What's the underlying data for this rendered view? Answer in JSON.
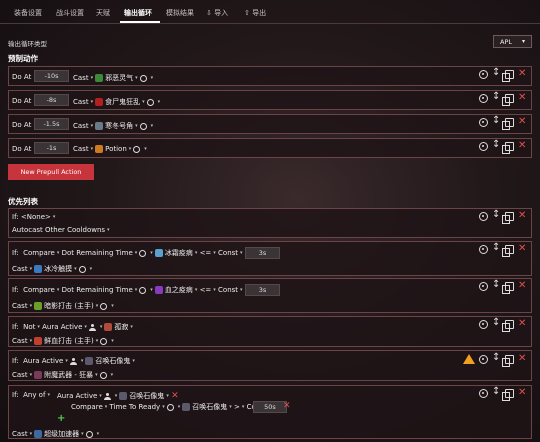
{
  "tabs": [
    "装备设置",
    "战斗设置",
    "天赋",
    "输出循环",
    "模拟结果",
    "导入",
    "导出"
  ],
  "active_tab": "输出循环",
  "section_type_label": "输出循环类型",
  "apl_select": "APL",
  "prepull_title": "预制动作",
  "prepull": [
    {
      "do_at": "Do At",
      "time": "-10s",
      "cast": "Cast",
      "spell": "邪恶灵气"
    },
    {
      "do_at": "Do At",
      "time": "-8s",
      "cast": "Cast",
      "spell": "食尸鬼狂乱"
    },
    {
      "do_at": "Do At",
      "time": "-1.5s",
      "cast": "Cast",
      "spell": "寒冬号角"
    },
    {
      "do_at": "Do At",
      "time": "-1s",
      "cast": "Cast",
      "spell": "Potion"
    }
  ],
  "new_prepull_button": "New Prepull Action",
  "priority_title": "优先列表",
  "priority": {
    "r1": {
      "if": "If:",
      "cond": "<None>",
      "action": "Autocast Other Cooldowns"
    },
    "r2": {
      "if": "If:",
      "compare": "Compare",
      "lhs": "Dot Remaining Time",
      "spell": "冰霜疫病",
      "op": "<=",
      "const": "Const",
      "val": "3s",
      "cast": "Cast",
      "cast_spell": "冰冷触摸"
    },
    "r3": {
      "if": "If:",
      "compare": "Compare",
      "lhs": "Dot Remaining Time",
      "spell": "血之疫病",
      "op": "<=",
      "const": "Const",
      "val": "3s",
      "cast": "Cast",
      "cast_spell": "暗影打击 (主手)"
    },
    "r4": {
      "if": "If:",
      "not": "Not",
      "aura": "Aura Active",
      "spell": "孤寂",
      "cast": "Cast",
      "cast_spell": "鲜血打击 (主手)"
    },
    "r5": {
      "if": "If:",
      "aura": "Aura Active",
      "spell": "召唤石像鬼",
      "cast": "Cast",
      "cast_spell": "附魔武器 - 狂暴"
    },
    "r6": {
      "if": "If:",
      "anyof": "Any of",
      "aura": "Aura Active",
      "spell": "召唤石像鬼",
      "compare": "Compare",
      "lhs": "Time To Ready",
      "spell2": "召唤石像鬼",
      "op": ">",
      "const": "Const",
      "val": "50s",
      "cast": "Cast",
      "cast_spell": "超级加速器"
    }
  }
}
